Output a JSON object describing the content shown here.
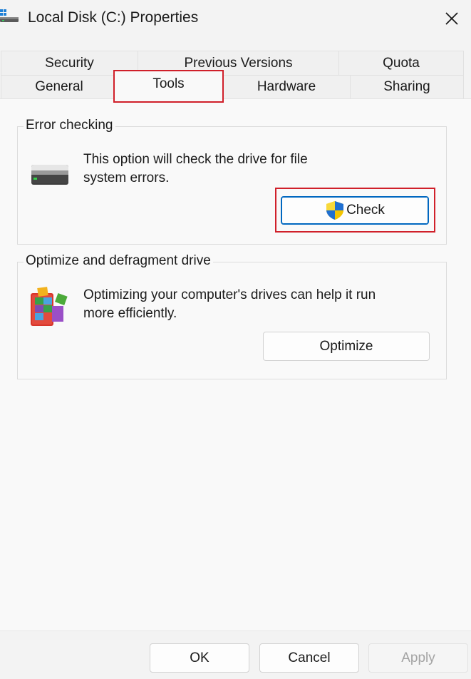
{
  "window": {
    "title": "Local Disk (C:) Properties",
    "icon": "drive-icon",
    "close_icon": "close-icon"
  },
  "tabs": {
    "row1": [
      {
        "label": "Security"
      },
      {
        "label": "Previous Versions"
      },
      {
        "label": "Quota"
      }
    ],
    "row2": [
      {
        "label": "General"
      },
      {
        "label": "Tools",
        "active": true
      },
      {
        "label": "Hardware"
      },
      {
        "label": "Sharing"
      }
    ]
  },
  "error_checking": {
    "group_label": "Error checking",
    "icon": "hard-drive-icon",
    "description_line1": "This option will check the drive for file",
    "description_line2": "system errors.",
    "button_label": "Check",
    "button_icon": "uac-shield-icon"
  },
  "optimize": {
    "group_label": "Optimize and defragment drive",
    "icon": "defrag-icon",
    "description_line1": "Optimizing your computer's drives can help it run",
    "description_line2": "more efficiently.",
    "button_label": "Optimize"
  },
  "footer": {
    "ok_label": "OK",
    "cancel_label": "Cancel",
    "apply_label": "Apply",
    "apply_enabled": false
  },
  "colors": {
    "highlight": "#d0202a",
    "accent": "#0067c0",
    "background": "#f3f3f3"
  }
}
